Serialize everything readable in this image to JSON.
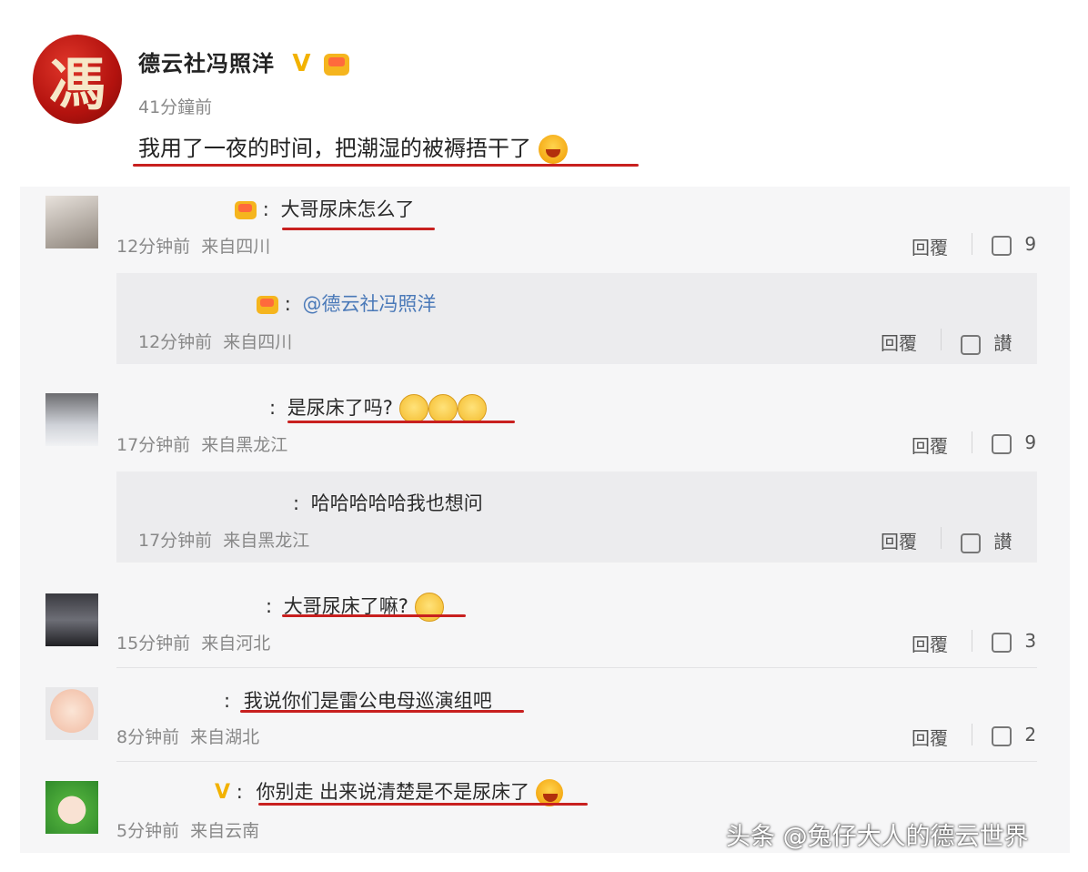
{
  "post": {
    "author": "德云社冯照洋",
    "avatar_glyph": "馮",
    "verified_badge": "V",
    "time": "41分鐘前",
    "text": "我用了一夜的时间，把潮湿的被褥捂干了"
  },
  "comments": [
    {
      "text": "大哥尿床怎么了",
      "prefix": ":",
      "time": "12分钟前",
      "location": "来自四川",
      "reply_label": "回覆",
      "likes": "9",
      "reply": {
        "prefix": ":",
        "mention": "@德云社冯照洋",
        "time": "12分钟前",
        "location": "来自四川",
        "reply_label": "回覆",
        "like_label": "讃"
      }
    },
    {
      "text": "是尿床了吗?",
      "prefix": ":",
      "time": "17分钟前",
      "location": "来自黑龙江",
      "reply_label": "回覆",
      "likes": "9",
      "reply": {
        "prefix": ":",
        "text": "哈哈哈哈哈我也想问",
        "time": "17分钟前",
        "location": "来自黑龙江",
        "reply_label": "回覆",
        "like_label": "讃"
      }
    },
    {
      "text": "大哥尿床了嘛?",
      "prefix": ":",
      "time": "15分钟前",
      "location": "来自河北",
      "reply_label": "回覆",
      "likes": "3"
    },
    {
      "text": "我说你们是雷公电母巡演组吧",
      "prefix": ":",
      "time": "8分钟前",
      "location": "来自湖北",
      "reply_label": "回覆",
      "likes": "2"
    },
    {
      "text": "你别走 出来说清楚是不是尿床了",
      "prefix": ":",
      "badge": "V",
      "time": "5分钟前",
      "location": "来自云南"
    }
  ],
  "watermark": "头条 @兔仔大人的德云世界",
  "colors": {
    "underline": "#c8201f",
    "vip_gold": "#f2b200",
    "mention": "#4a79b8",
    "panel_bg": "#f6f6f7"
  }
}
